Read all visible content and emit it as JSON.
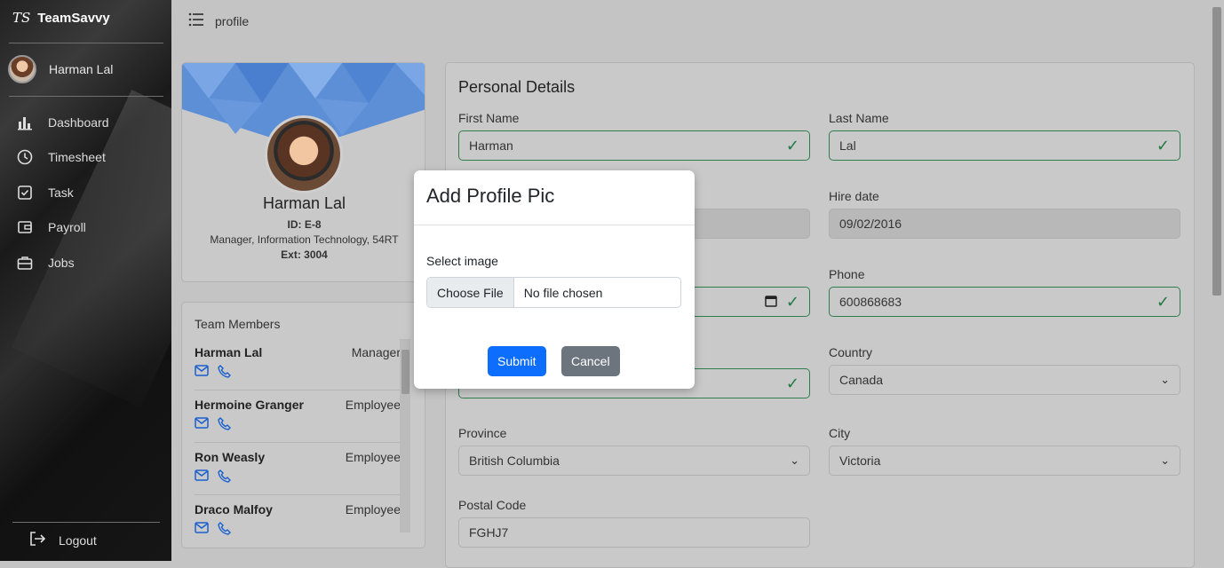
{
  "sidebar": {
    "brand_logo": "TS",
    "brand_name": "TeamSavvy",
    "user_name": "Harman Lal",
    "nav": [
      {
        "label": "Dashboard",
        "icon": "bar-chart-icon"
      },
      {
        "label": "Timesheet",
        "icon": "clock-icon"
      },
      {
        "label": "Task",
        "icon": "checkbox-icon"
      },
      {
        "label": "Payroll",
        "icon": "wallet-icon"
      },
      {
        "label": "Jobs",
        "icon": "briefcase-icon"
      }
    ],
    "logout_label": "Logout"
  },
  "topbar": {
    "title": "profile",
    "menu_icon": "list-icon"
  },
  "profile": {
    "name": "Harman Lal",
    "id": "ID: E-8",
    "position": "Manager, Information Technology, 54RT",
    "ext": "Ext: 3004"
  },
  "team": {
    "title": "Team Members",
    "members": [
      {
        "name": "Harman Lal",
        "role": "Manager"
      },
      {
        "name": "Hermoine Granger",
        "role": "Employee"
      },
      {
        "name": "Ron Weasly",
        "role": "Employee"
      },
      {
        "name": "Draco Malfoy",
        "role": "Employee"
      }
    ]
  },
  "details": {
    "title": "Personal Details",
    "first_name_label": "First Name",
    "first_name": "Harman",
    "last_name_label": "Last Name",
    "last_name": "Lal",
    "hire_date_label": "Hire date",
    "hire_date": "09/02/2016",
    "phone_label": "Phone",
    "phone": "600868683",
    "country_label": "Country",
    "country": "Canada",
    "province_label": "Province",
    "province": "British Columbia",
    "city_label": "City",
    "city": "Victoria",
    "postal_label": "Postal Code",
    "postal": "FGHJ7"
  },
  "modal": {
    "title": "Add Profile Pic",
    "select_label": "Select image",
    "file_button": "Choose File",
    "file_status": "No file chosen",
    "submit": "Submit",
    "cancel": "Cancel"
  },
  "colors": {
    "primary": "#0d6efd",
    "secondary": "#6c757d",
    "valid": "#1f7a43",
    "link_icon": "#1a5fd0"
  }
}
